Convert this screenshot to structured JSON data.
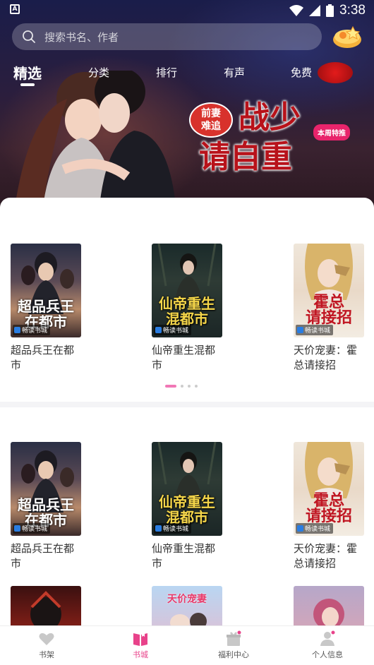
{
  "status_bar": {
    "time": "3:38"
  },
  "search": {
    "placeholder": "搜索书名、作者"
  },
  "tabs": [
    {
      "label": "精选",
      "active": true
    },
    {
      "label": "分类"
    },
    {
      "label": "排行"
    },
    {
      "label": "有声"
    },
    {
      "label": "免费"
    }
  ],
  "banner": {
    "badge": "前妻\n难追",
    "title_line1": "战少",
    "title_line2": "请自重",
    "tag": "本周特推"
  },
  "section1": {
    "books": [
      {
        "title": "超品兵王在都市",
        "cover_text": "超品兵王\n在都市",
        "publisher": "畅读书城"
      },
      {
        "title": "仙帝重生混都市",
        "cover_text": "仙帝重生\n混都市",
        "publisher": "畅读书城"
      },
      {
        "title": "天价宠妻：霍总请接招",
        "cover_text": "霍总\n请接招",
        "publisher": "畅读书城"
      }
    ],
    "carousel_dots": 4,
    "carousel_active_index": 0
  },
  "section2": {
    "books": [
      {
        "title": "超品兵王在都市",
        "cover_text": "超品兵王\n在都市",
        "publisher": "畅读书城"
      },
      {
        "title": "仙帝重生混都市",
        "cover_text": "仙帝重生\n混都市",
        "publisher": "畅读书城"
      },
      {
        "title": "天价宠妻：霍总请接招",
        "cover_text": "霍总\n请接招",
        "publisher": "畅读书城"
      }
    ],
    "partial_row_covers": [
      "",
      "天价宠妻",
      ""
    ]
  },
  "bottom_nav": [
    {
      "label": "书架",
      "icon": "heart-icon"
    },
    {
      "label": "书城",
      "icon": "book-icon",
      "active": true
    },
    {
      "label": "福利中心",
      "icon": "gift-box-icon"
    },
    {
      "label": "个人信息",
      "icon": "person-icon"
    }
  ],
  "colors": {
    "accent": "#e8428a",
    "dot_active": "#f178b6",
    "banner_title": "#b8121a"
  }
}
